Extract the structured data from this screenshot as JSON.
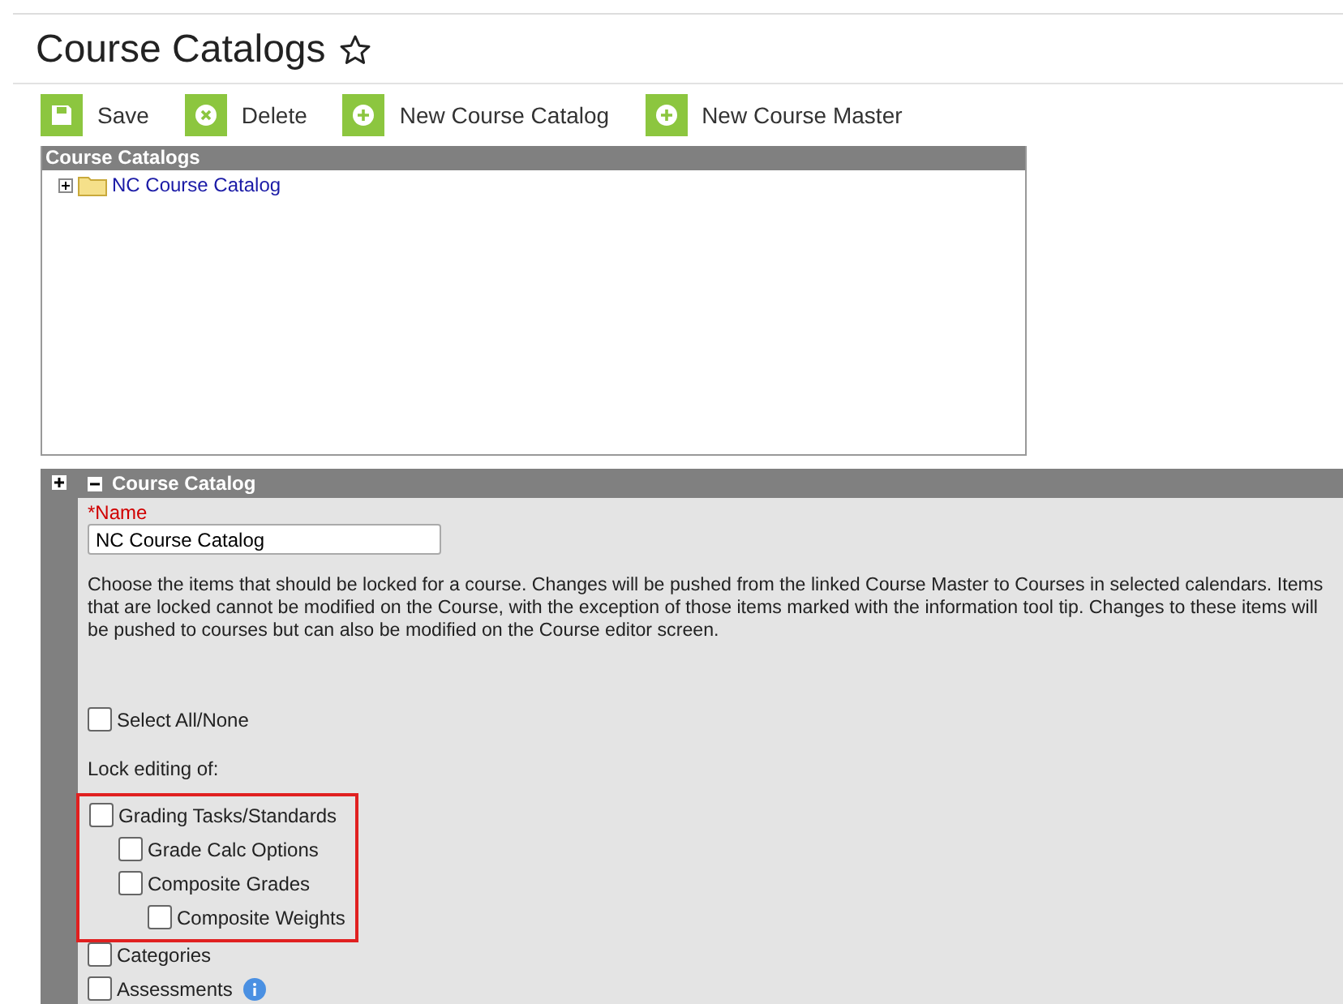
{
  "page": {
    "title": "Course Catalogs",
    "favorite": false
  },
  "toolbar": [
    {
      "label": "Save",
      "kind": "save"
    },
    {
      "label": "Delete",
      "kind": "delete"
    },
    {
      "label": "New Course Catalog",
      "kind": "add"
    },
    {
      "label": "New Course Master",
      "kind": "add"
    }
  ],
  "tree": {
    "title": "Course Catalogs",
    "items": [
      {
        "label": "NC Course Catalog",
        "expanded": false
      }
    ]
  },
  "detail": {
    "expanded": true,
    "title": "Course Catalog",
    "name_label": "*Name",
    "name_value": "NC Course Catalog",
    "description": "Choose the items that should be locked for a course. Changes will be pushed from the linked Course Master to Courses in selected calendars. Items that are locked cannot be modified on the Course, with the exception of those items marked with the information tool tip. Changes to these items will be pushed to courses but can also be modified on the Course editor screen.",
    "select_all": {
      "label": "Select All/None",
      "checked": false
    },
    "lock_label": "Lock editing of:",
    "lock_items": [
      {
        "label": "Grading Tasks/Standards",
        "checked": false,
        "highlighted": true,
        "info": false,
        "children": [
          {
            "label": "Grade Calc Options",
            "checked": false,
            "info": false
          },
          {
            "label": "Composite Grades",
            "checked": false,
            "info": false,
            "children": [
              {
                "label": "Composite Weights",
                "checked": false,
                "info": false
              }
            ]
          }
        ]
      },
      {
        "label": "Categories",
        "checked": false,
        "highlighted": false,
        "info": false
      },
      {
        "label": "Assessments",
        "checked": false,
        "highlighted": false,
        "info": true
      }
    ]
  }
}
